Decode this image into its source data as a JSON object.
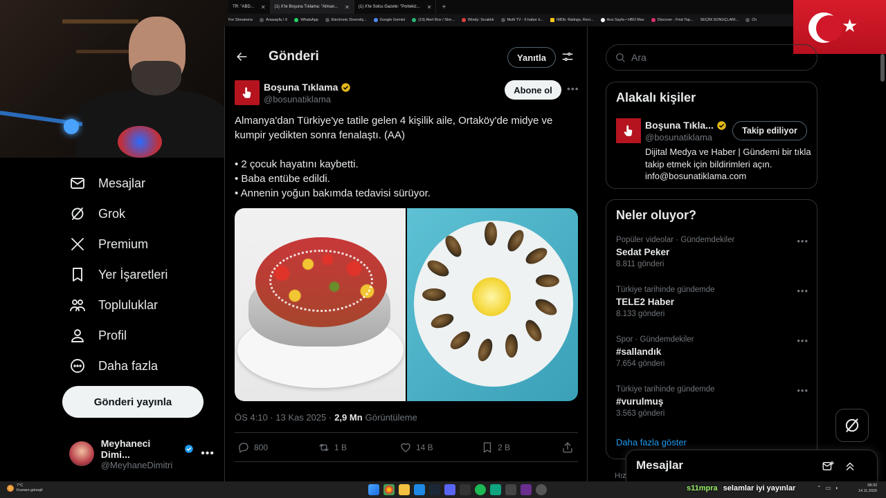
{
  "browser": {
    "tabs": [
      {
        "label": "TR: \"ABD...",
        "active": false
      },
      {
        "label": "(1) X'te Boşuna Tıklama: \"Alman...",
        "active": true
      },
      {
        "label": "(1) X'te Solcu Gazete: \"Portekiz...",
        "active": false
      }
    ],
    "bookmarks": [
      "For Streamers",
      "Anasayfa / X",
      "WhatsApp",
      "Electronic Diversity...",
      "Google Gemini",
      "(19) Alert Box / Stre...",
      "Windy: Sıcaklık",
      "Multi TV - 6 haber k...",
      "IMDb: Ratings, Revi...",
      "Ana Sayfa • HBO Max",
      "Discover - Find Top...",
      "SEÇİM SONUÇLARI...",
      "Ch"
    ]
  },
  "nav": {
    "items": [
      {
        "label": "Mesajlar",
        "icon": "mail-icon"
      },
      {
        "label": "Grok",
        "icon": "grok-icon"
      },
      {
        "label": "Premium",
        "icon": "x-logo-icon"
      },
      {
        "label": "Yer İşaretleri",
        "icon": "bookmark-icon"
      },
      {
        "label": "Topluluklar",
        "icon": "communities-icon"
      },
      {
        "label": "Profil",
        "icon": "profile-icon"
      },
      {
        "label": "Daha fazla",
        "icon": "more-circle-icon"
      }
    ],
    "post_button": "Gönderi yayınla",
    "account": {
      "name": "Meyhaneci Dimi...",
      "handle": "@MeyhaneDimitri"
    }
  },
  "header": {
    "title": "Gönderi",
    "reply_button": "Yanıtla"
  },
  "tweet": {
    "author_name": "Boşuna Tıklama",
    "author_handle": "@bosunatiklama",
    "follow_button": "Abone ol",
    "text_line1": "Almanya'dan Türkiye'ye tatile gelen 4 kişilik aile, Ortaköy'de midye ve kumpir yedikten sonra fenalaştı. (AA)",
    "bullet1": "• 2 çocuk hayatını kaybetti.",
    "bullet2": "• Baba entübe edildi.",
    "bullet3": "• Annenin yoğun bakımda tedavisi sürüyor.",
    "time": "ÖS 4:10 · 13 Kas 2025 ·",
    "views": "2,9 Mn",
    "views_label": "Görüntüleme",
    "replies": "800",
    "retweets": "1 B",
    "likes": "14 B",
    "bookmarks": "2 B"
  },
  "search": {
    "placeholder": "Ara"
  },
  "related": {
    "title": "Alakalı kişiler",
    "name": "Boşuna Tıkla...",
    "handle": "@bosunatiklama",
    "follow_button": "Takip ediliyor",
    "bio": "Dijital Medya ve Haber | Gündemi bir tıkla takip etmek için bildirimleri açın. info@bosunatiklama.com"
  },
  "trends": {
    "title": "Neler oluyor?",
    "items": [
      {
        "context": "Popüler videolar · Gündemdekiler",
        "name": "Sedat Peker",
        "count": "8.811 gönderi"
      },
      {
        "context": "Türkiye tarihinde gündemde",
        "name": "TELE2 Haber",
        "count": "8.133 gönderi"
      },
      {
        "context": "Spor · Gündemdekiler",
        "name": "#sallandık",
        "count": "7.654 gönderi"
      },
      {
        "context": "Türkiye tarihinde gündemde",
        "name": "#vurulmuş",
        "count": "3.563 gönderi"
      }
    ],
    "show_more": "Daha fazla göster"
  },
  "messages_drawer": {
    "title": "Mesajlar"
  },
  "footer_hint": "Hızı",
  "taskbar": {
    "weather_temp": "7°C",
    "weather_desc": "Kısmen güneşli",
    "chat_user": "s11mpra",
    "chat_message": "selamlar iyi yayınlar",
    "time": "08:32",
    "date": "14.11.2025"
  },
  "colors": {
    "accent": "#1d9bf0",
    "verified_gold": "#e2b719",
    "verified_blue": "#1d9bf0",
    "brand_red": "#b5141f"
  }
}
